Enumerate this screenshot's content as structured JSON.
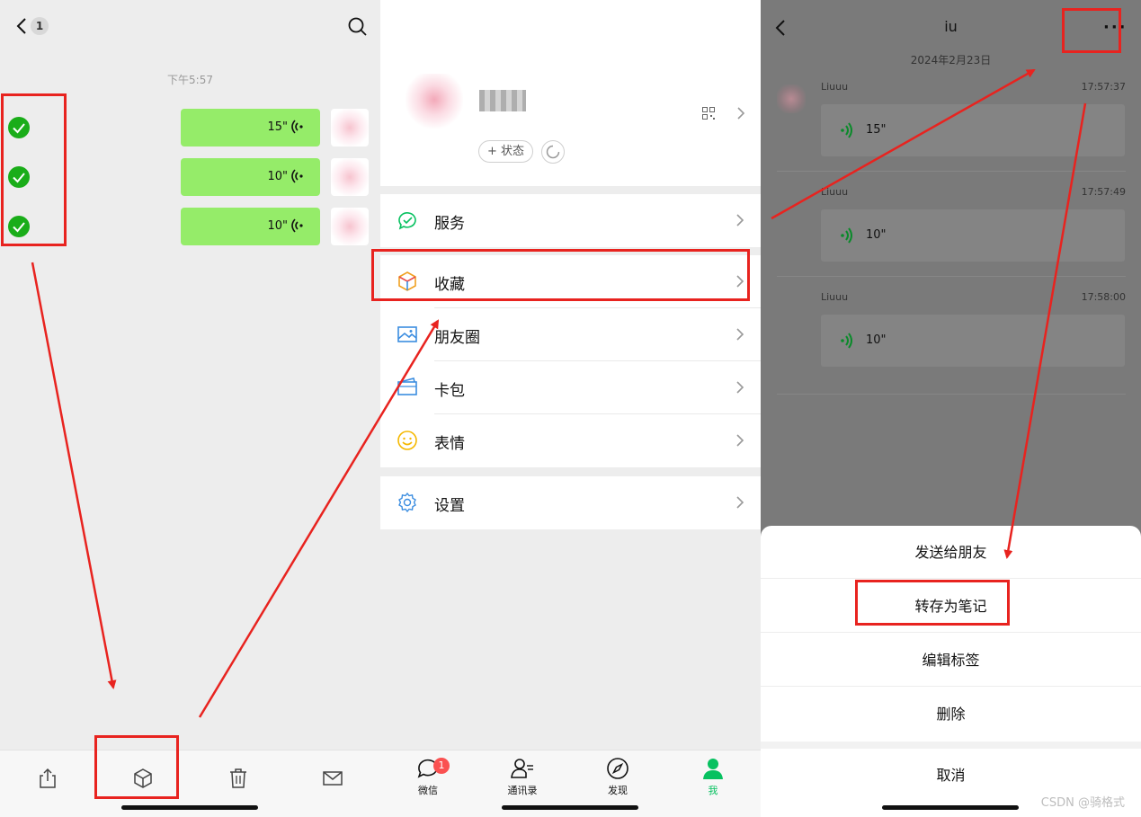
{
  "chat_select": {
    "back_count": "1",
    "time_divider": "下午5:57",
    "voice_messages": [
      {
        "duration": "15\""
      },
      {
        "duration": "10\""
      },
      {
        "duration": "10\""
      }
    ],
    "bottom_actions": [
      "share-icon",
      "favorite-icon",
      "trash-icon",
      "mail-icon"
    ]
  },
  "me_tab": {
    "nickname": "Liuuu",
    "status_button": "+ 状态",
    "menu": [
      {
        "label": "服务",
        "icon": "service-icon"
      },
      {
        "label": "收藏",
        "icon": "favorites-cube-icon"
      },
      {
        "label": "朋友圈",
        "icon": "moments-image-icon"
      },
      {
        "label": "卡包",
        "icon": "card-wallet-icon"
      },
      {
        "label": "表情",
        "icon": "sticker-smile-icon"
      },
      {
        "label": "设置",
        "icon": "settings-gear-icon"
      }
    ],
    "tabs": [
      {
        "label": "微信",
        "badge": "1"
      },
      {
        "label": "通讯录"
      },
      {
        "label": "发现"
      },
      {
        "label": "我"
      }
    ]
  },
  "favorite_detail": {
    "title": "iu",
    "more": "···",
    "date": "2024年2月23日",
    "items": [
      {
        "sender": "Liuuu",
        "time": "17:57:37",
        "duration": "15\""
      },
      {
        "sender": "Liuuu",
        "time": "17:57:49",
        "duration": "10\""
      },
      {
        "sender": "Liuuu",
        "time": "17:58:00",
        "duration": "10\""
      }
    ],
    "sheet": {
      "send_to_friend": "发送给朋友",
      "save_as_note": "转存为笔记",
      "edit_tags": "编辑标签",
      "delete": "删除",
      "cancel": "取消"
    }
  },
  "watermark": "CSDN @骑格式",
  "colors": {
    "accent_green": "#07c160",
    "bubble_green": "#95ec69",
    "annotation_red": "#e8231f"
  }
}
